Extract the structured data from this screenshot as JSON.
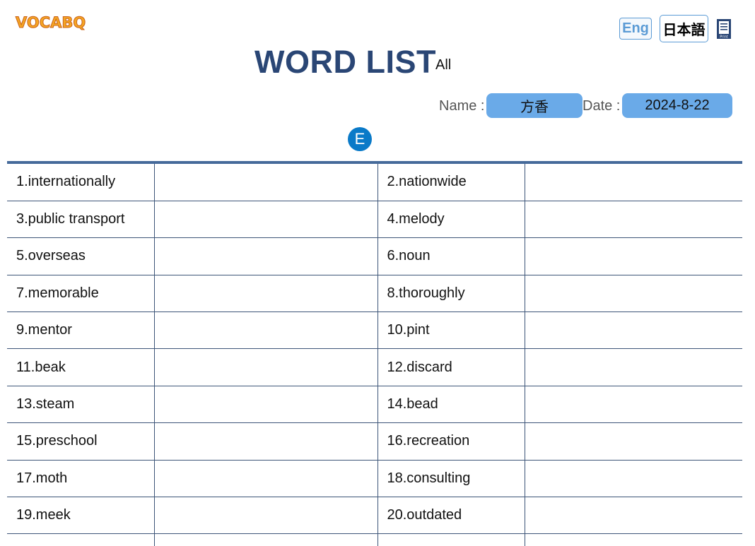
{
  "logo": {
    "text": "VOCABQ"
  },
  "header": {
    "lang_eng": "Eng",
    "lang_ja": "日本語",
    "print_label": "Print",
    "title": "WORD LIST",
    "subtitle": "All"
  },
  "form": {
    "name_label": "Name :",
    "name_value": "方香",
    "date_label": "Date :",
    "date_value": "2024-8-22"
  },
  "badge": {
    "label": "E"
  },
  "rows": [
    {
      "left": "1.internationally",
      "right": "2.nationwide"
    },
    {
      "left": "3.public transport",
      "right": "4.melody"
    },
    {
      "left": "5.overseas",
      "right": "6.noun"
    },
    {
      "left": "7.memorable",
      "right": "8.thoroughly"
    },
    {
      "left": "9.mentor",
      "right": "10.pint"
    },
    {
      "left": "11.beak",
      "right": "12.discard"
    },
    {
      "left": "13.steam",
      "right": "14.bead"
    },
    {
      "left": "15.preschool",
      "right": "16.recreation"
    },
    {
      "left": "17.moth",
      "right": "18.consulting"
    },
    {
      "left": "19.meek",
      "right": "20.outdated"
    }
  ],
  "colors": {
    "title": "#2a4675",
    "field_bg": "#6aaae8",
    "badge_bg": "#0a7ac8",
    "logo": "#f5a623",
    "table_border": "#3d5578"
  }
}
